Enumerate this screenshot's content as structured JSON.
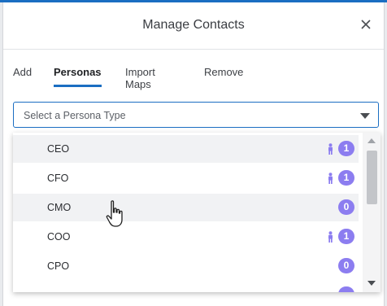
{
  "modal": {
    "title": "Manage Contacts"
  },
  "tabs": [
    {
      "label": "Add",
      "active": false
    },
    {
      "label": "Personas",
      "active": true
    },
    {
      "label": "Import Maps",
      "active": false
    },
    {
      "label": "Remove",
      "active": false
    }
  ],
  "persona_select": {
    "placeholder": "Select a Persona Type"
  },
  "persona_list": [
    {
      "label": "CEO",
      "count": "1",
      "has_person_icon": true
    },
    {
      "label": "CFO",
      "count": "1",
      "has_person_icon": true
    },
    {
      "label": "CMO",
      "count": "0",
      "has_person_icon": false
    },
    {
      "label": "COO",
      "count": "1",
      "has_person_icon": true
    },
    {
      "label": "CPO",
      "count": "0",
      "has_person_icon": false
    }
  ],
  "colors": {
    "accent": "#1b6ec2",
    "badge": "#8c7df0"
  }
}
